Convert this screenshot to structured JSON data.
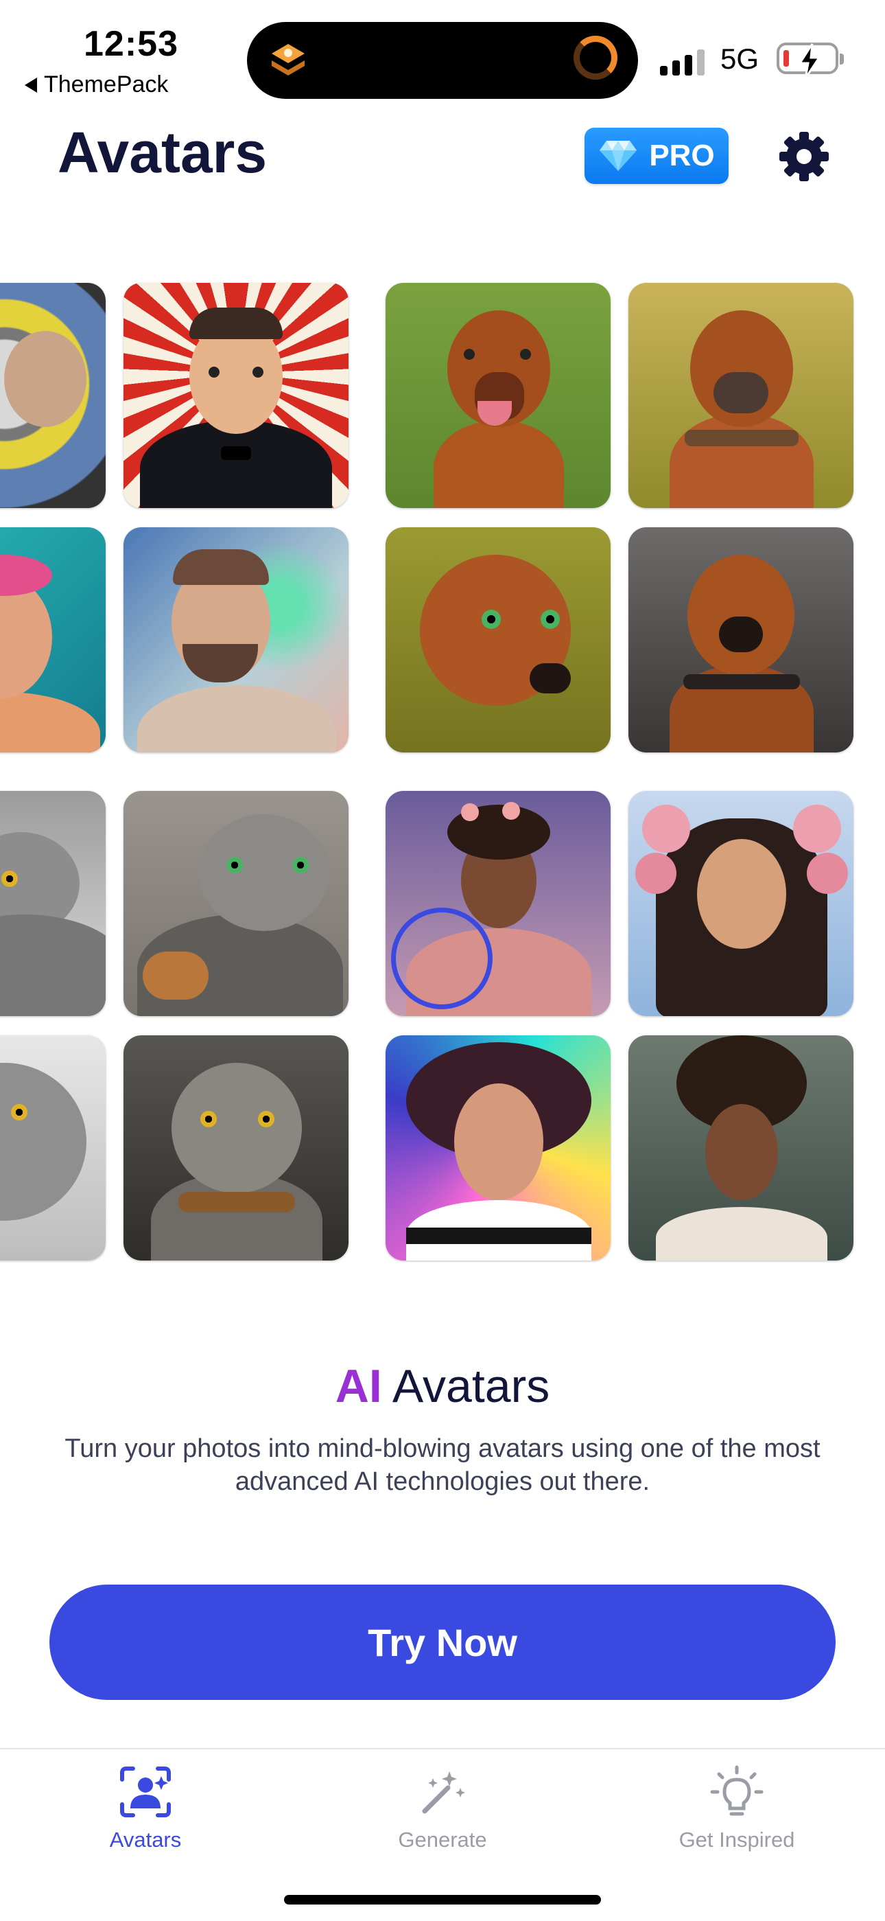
{
  "status_bar": {
    "time": "12:53",
    "back_app": "ThemePack",
    "network": "5G",
    "signal_bars_filled": 3,
    "battery": "low-charging"
  },
  "header": {
    "title": "Avatars",
    "pro_label": "PRO",
    "pro_icon": "diamond-icon",
    "settings_icon": "gear-icon"
  },
  "gallery": {
    "tiles": [
      "astronaut",
      "tuxedo-man",
      "dog-smiling",
      "dog-collar",
      "man-pink-hair",
      "man-painted",
      "dog-green-eyes",
      "dog-portrait",
      "cat-lying",
      "cat-armor",
      "girl-pink-dress",
      "girl-flower-crown",
      "cat-sketch",
      "cat-collar",
      "girl-galaxy",
      "girl-afro"
    ]
  },
  "promo": {
    "title_highlight": "AI",
    "title_rest": " Avatars",
    "description": "Turn your photos into mind-blowing avatars using one of the most advanced AI technologies out there."
  },
  "cta": {
    "label": "Try Now"
  },
  "tabs": [
    {
      "label": "Avatars",
      "icon": "avatar-scan-icon",
      "active": true
    },
    {
      "label": "Generate",
      "icon": "magic-wand-icon",
      "active": false
    },
    {
      "label": "Get Inspired",
      "icon": "lightbulb-icon",
      "active": false
    }
  ],
  "colors": {
    "accent": "#3a4ae0",
    "title": "#11163a",
    "ai_highlight": "#9a2fd6",
    "pro_badge": "#1a8cff",
    "inactive_tab": "#9a9ca6"
  }
}
